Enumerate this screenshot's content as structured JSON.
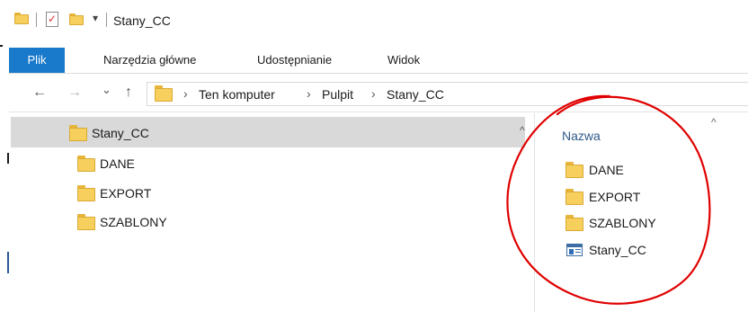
{
  "window": {
    "title": "Stany_CC",
    "qat_dropdown_glyph": "▾"
  },
  "ribbon": {
    "tabs": [
      {
        "label": "Plik",
        "active": true
      },
      {
        "label": "Narzędzia główne"
      },
      {
        "label": "Udostępnianie"
      },
      {
        "label": "Widok"
      }
    ],
    "active_color": "#1979ca"
  },
  "navigation": {
    "back_glyph": "←",
    "forward_glyph": "→",
    "recent_glyph": "⌄",
    "up_glyph": "↑",
    "breadcrumb": [
      "Ten komputer",
      "Pulpit",
      "Stany_CC"
    ],
    "separator": "›"
  },
  "tree": {
    "root": {
      "label": "Stany_CC",
      "icon": "folder-icon",
      "selected": true
    },
    "children": [
      {
        "label": "DANE",
        "icon": "folder-icon"
      },
      {
        "label": "EXPORT",
        "icon": "folder-icon"
      },
      {
        "label": "SZABLONY",
        "icon": "folder-icon"
      }
    ],
    "scroll_glyph": "^"
  },
  "content": {
    "column_header": "Nazwa",
    "sort_glyph": "^",
    "items": [
      {
        "label": "DANE",
        "icon": "folder-icon"
      },
      {
        "label": "EXPORT",
        "icon": "folder-icon"
      },
      {
        "label": "SZABLONY",
        "icon": "folder-icon"
      },
      {
        "label": "Stany_CC",
        "icon": "application-icon"
      }
    ]
  },
  "annotation": {
    "color": "#e00000",
    "shape": "hand-drawn-circle"
  }
}
